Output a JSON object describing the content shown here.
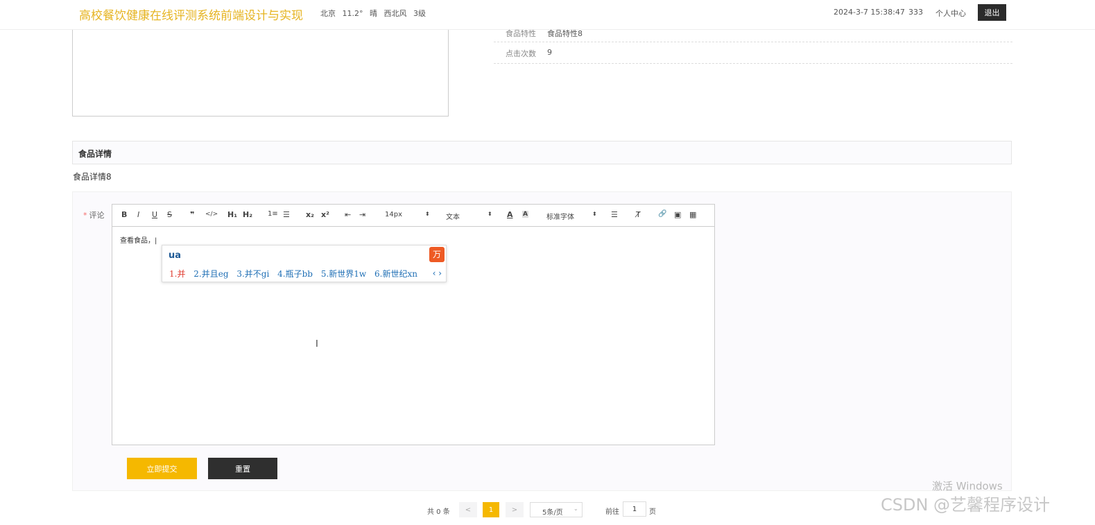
{
  "header": {
    "title": "高校餐饮健康在线评测系统前端设计与实现",
    "weather": {
      "city": "北京",
      "temp": "11.2°",
      "condition": "晴",
      "wind": "西北风",
      "level": "3级"
    },
    "datetime": "2024-3-7 15:38:47",
    "username": "333",
    "profile_link": "个人中心",
    "logout": "退出"
  },
  "info": {
    "rows": [
      {
        "label": "食品特性",
        "value": "食品特性8"
      },
      {
        "label": "点击次数",
        "value": "9"
      }
    ]
  },
  "detail": {
    "heading": "食品详情",
    "text": "食品详情8"
  },
  "comment": {
    "required_mark": "*",
    "label": "评论",
    "editor_text": "查看食品，|",
    "toolbar": {
      "bold": "B",
      "italic": "I",
      "underline": "U",
      "strike": "S",
      "quote": "❞",
      "code": "</>",
      "h1": "H₁",
      "h2": "H₂",
      "ordered_list": "1≡",
      "bullet_list": "☰",
      "subscript": "x₂",
      "superscript": "x²",
      "outdent": "⇤",
      "indent": "⇥",
      "font_size": "14px",
      "text_type": "文本",
      "font_color": "A",
      "bg_color": "A",
      "font_family": "标准字体",
      "align": "☰",
      "clean": "T̸",
      "link": "🔗",
      "image": "▣",
      "video": "▦"
    },
    "ime": {
      "composition": "ua",
      "logo": "万",
      "candidates": [
        "1.并",
        "2.并且eg",
        "3.并不gi",
        "4.瓶子bb",
        "5.新世界1w",
        "6.新世纪xn"
      ],
      "nav": "‹ ›"
    },
    "submit": "立即提交",
    "reset": "重置"
  },
  "pagination": {
    "total": "共 0 条",
    "prev": "<",
    "current": "1",
    "next": ">",
    "page_size": "5条/页",
    "goto_label": "前往",
    "goto_value": "1",
    "goto_unit": "页"
  },
  "watermarks": {
    "windows": "激活 Windows",
    "csdn": "CSDN @艺馨程序设计"
  }
}
